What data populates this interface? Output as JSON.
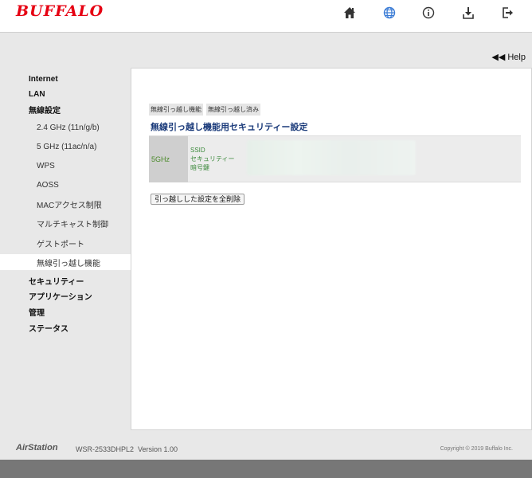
{
  "header": {
    "logo": "BUFFALO",
    "icons": [
      "home-icon",
      "globe-icon",
      "info-icon",
      "download-icon",
      "logout-icon"
    ]
  },
  "help_label": "◀◀ Help",
  "sidebar": {
    "items": [
      {
        "label": "Internet",
        "level": "top"
      },
      {
        "label": "LAN",
        "level": "top"
      },
      {
        "label": "無線設定",
        "level": "top"
      },
      {
        "label": "2.4 GHz (11n/g/b)",
        "level": "sub"
      },
      {
        "label": "5 GHz (11ac/n/a)",
        "level": "sub"
      },
      {
        "label": "WPS",
        "level": "sub"
      },
      {
        "label": "AOSS",
        "level": "sub"
      },
      {
        "label": "MACアクセス制限",
        "level": "sub"
      },
      {
        "label": "マルチキャスト制御",
        "level": "sub"
      },
      {
        "label": "ゲストポート",
        "level": "sub"
      },
      {
        "label": "無線引っ越し機能",
        "level": "sub",
        "active": true
      },
      {
        "label": "セキュリティー",
        "level": "top"
      },
      {
        "label": "アプリケーション",
        "level": "top"
      },
      {
        "label": "管理",
        "level": "top"
      },
      {
        "label": "ステータス",
        "level": "top"
      }
    ]
  },
  "main": {
    "breadcrumbs": [
      "無線引っ越し機能",
      "無線引っ越し済み"
    ],
    "section_title": "無線引っ越し機能用セキュリティー設定",
    "row": {
      "band": "5GHz",
      "fields": [
        "SSID",
        "セキュリティー",
        "暗号鍵"
      ]
    },
    "delete_button": "引っ越しした設定を全削除"
  },
  "footer": {
    "brand": "AirStation",
    "model": "WSR-2533DHPL2  Version 1.00",
    "copyright": "Copyright © 2019 Buffalo Inc."
  },
  "colors": {
    "logo": "#e60012",
    "title": "#1a3a7a",
    "field_text": "#3d8a3d",
    "icon_blue": "#3a7bd5"
  }
}
